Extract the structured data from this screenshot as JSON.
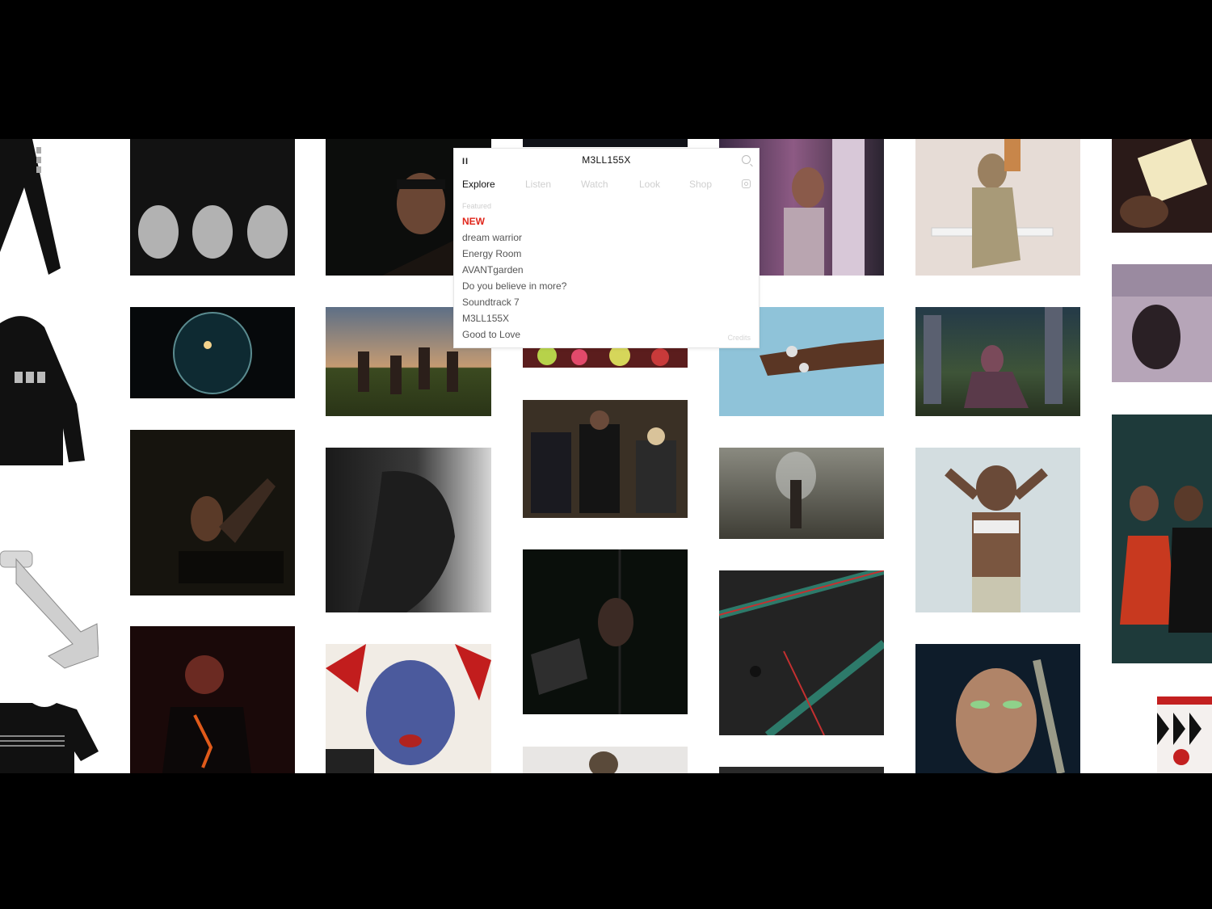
{
  "site": {
    "title": "M3LL155X",
    "pause_label": "II"
  },
  "menu": {
    "tabs": [
      {
        "label": "Explore",
        "active": true
      },
      {
        "label": "Listen",
        "active": false
      },
      {
        "label": "Watch",
        "active": false
      },
      {
        "label": "Look",
        "active": false
      },
      {
        "label": "Shop",
        "active": false
      }
    ],
    "section_label": "Featured",
    "items": [
      "NEW",
      "dream warrior",
      "Energy Room",
      "AVANTgarden",
      "Do you believe in more?",
      "Soundtrack 7",
      "M3LL155X",
      "Good to Love"
    ],
    "credits_label": "Credits"
  },
  "icons": {
    "search": "search-icon",
    "instagram": "instagram-icon",
    "pause": "pause-icon"
  },
  "colors": {
    "accent_new": "#e0261b",
    "background": "#ffffff",
    "letterbox": "#000000"
  },
  "gallery": {
    "tiles": [
      {
        "name": "tile-merch-tee-heads"
      },
      {
        "name": "tile-orb-space"
      },
      {
        "name": "tile-dancer-dark"
      },
      {
        "name": "tile-red-light-crowd"
      },
      {
        "name": "tile-portrait-headband"
      },
      {
        "name": "tile-runners-field"
      },
      {
        "name": "tile-profile-bw"
      },
      {
        "name": "tile-collage-blue-face"
      },
      {
        "name": "tile-flowers"
      },
      {
        "name": "tile-party-scene"
      },
      {
        "name": "tile-aerial-rope"
      },
      {
        "name": "tile-dancers-bottom"
      },
      {
        "name": "tile-pink-doorway"
      },
      {
        "name": "tile-hand-rings"
      },
      {
        "name": "tile-greenhouse-figure"
      },
      {
        "name": "tile-satin-fabric"
      },
      {
        "name": "tile-dark-bottom"
      },
      {
        "name": "tile-bench-sitter"
      },
      {
        "name": "tile-ruins-pose"
      },
      {
        "name": "tile-hands-on-head"
      },
      {
        "name": "tile-green-eyeshadow"
      },
      {
        "name": "tile-tarot-card"
      },
      {
        "name": "tile-screen-text"
      },
      {
        "name": "tile-trio-red"
      },
      {
        "name": "tile-patterned-shorts"
      }
    ],
    "products": [
      {
        "name": "product-sweatpants"
      },
      {
        "name": "product-hoodie"
      },
      {
        "name": "product-metal-chain"
      },
      {
        "name": "product-tshirt"
      }
    ]
  }
}
